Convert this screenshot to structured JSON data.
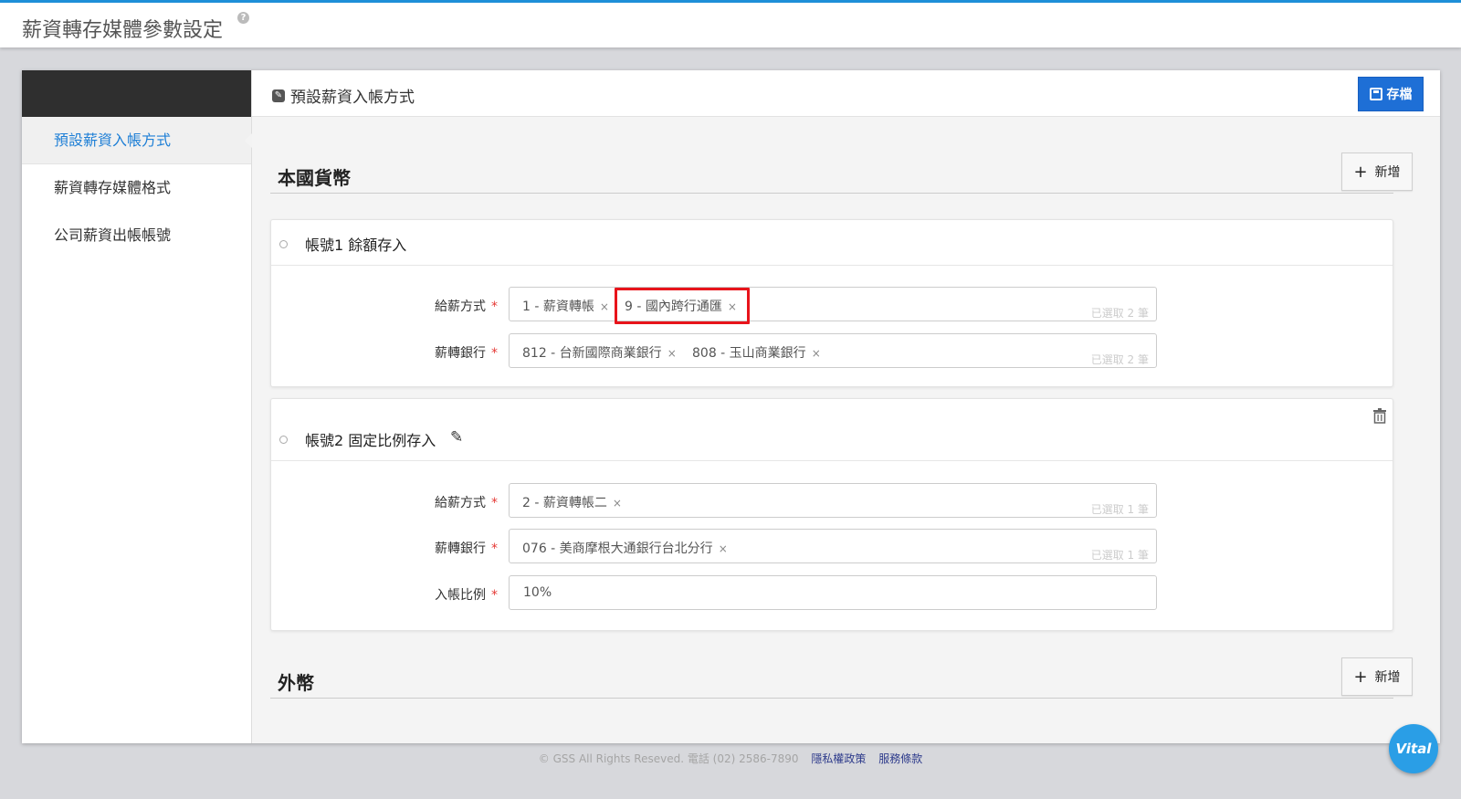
{
  "page": {
    "title": "薪資轉存媒體參數設定",
    "help_icon": "?"
  },
  "sidebar": {
    "items": [
      {
        "label": "預設薪資入帳方式"
      },
      {
        "label": "薪資轉存媒體格式"
      },
      {
        "label": "公司薪資出帳帳號"
      }
    ]
  },
  "main": {
    "header_title": "預設薪資入帳方式",
    "save_label": "存檔"
  },
  "domestic": {
    "title": "本國貨幣",
    "add_label": "新增",
    "accounts": [
      {
        "title": "帳號1  餘額存入",
        "fields": [
          {
            "label": "給薪方式",
            "tags": [
              "1 - 薪資轉帳",
              "9 - 國內跨行通匯"
            ],
            "count": "已選取 2 筆"
          },
          {
            "label": "薪轉銀行",
            "tags": [
              "812 - 台新國際商業銀行",
              "808 - 玉山商業銀行"
            ],
            "count": "已選取 2 筆"
          }
        ]
      },
      {
        "title": "帳號2  固定比例存入",
        "fields": [
          {
            "label": "給薪方式",
            "tags": [
              "2 - 薪資轉帳二"
            ],
            "count": "已選取 1 筆"
          },
          {
            "label": "薪轉銀行",
            "tags": [
              "076 - 美商摩根大通銀行台北分行"
            ],
            "count": "已選取 1 筆"
          },
          {
            "label": "入帳比例",
            "value": "10%"
          }
        ]
      }
    ]
  },
  "foreign": {
    "title": "外幣",
    "add_label": "新增"
  },
  "footer": {
    "copyright": "© GSS All Rights Reseved. 電話 (02) 2586-7890",
    "privacy": "隱私權政策",
    "terms": "服務條款"
  },
  "widget": {
    "label": "Vital"
  },
  "icons": {
    "remove": "×",
    "required": "*",
    "plus": "+",
    "pen": "✎"
  },
  "colors": {
    "accent": "#1e7fd6",
    "save_button": "#1e6fd6",
    "required": "#e53935",
    "highlight": "#e8141b",
    "top_border": "#1e8fd8"
  }
}
